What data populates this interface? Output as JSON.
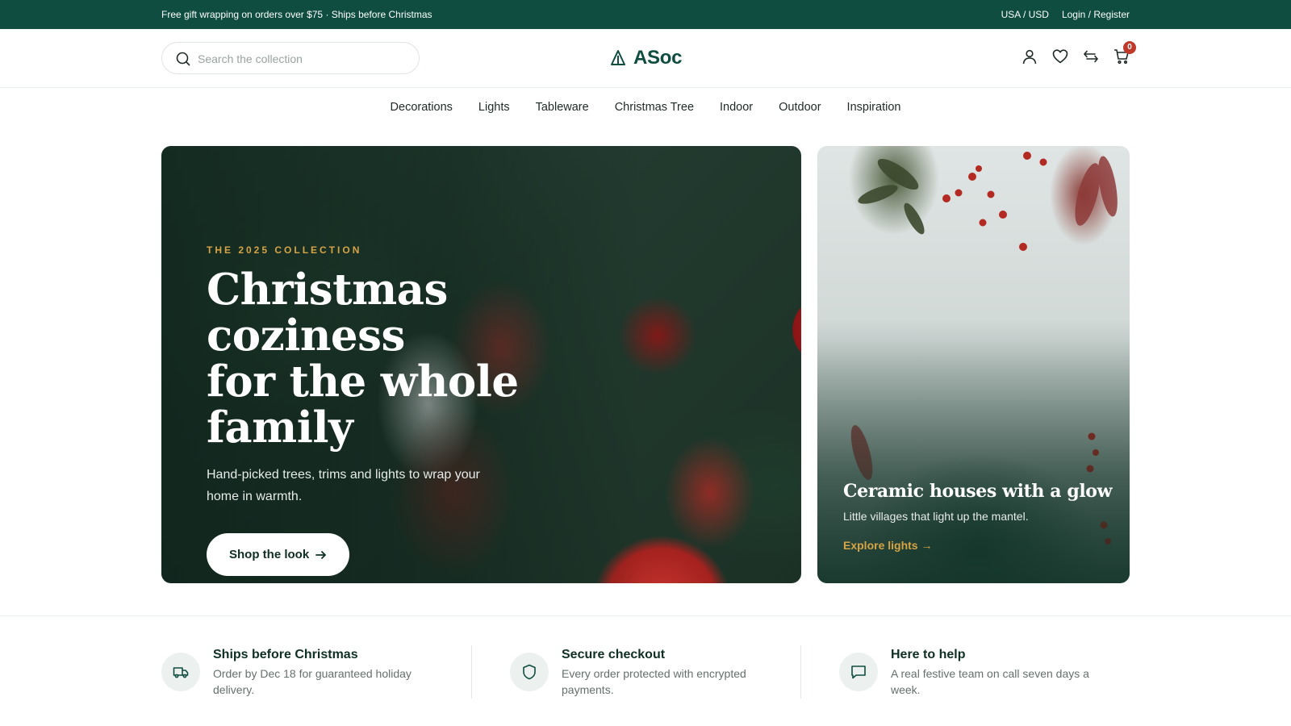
{
  "topbar": {
    "promo": "Free gift wrapping on orders over $75 · Ships before Christmas",
    "region": "USA / USD",
    "auth": "Login / Register"
  },
  "header": {
    "search_placeholder": "Search the collection",
    "logo": "ASoc",
    "cart_count": "0",
    "icons": [
      "user-icon",
      "heart-icon",
      "compare-icon",
      "cart-icon"
    ]
  },
  "nav": {
    "items": [
      "Decorations",
      "Lights",
      "Tableware",
      "Christmas Tree",
      "Indoor",
      "Outdoor",
      "Inspiration"
    ]
  },
  "hero": {
    "eyebrow": "THE 2025 COLLECTION",
    "title_line1": "Christmas coziness",
    "title_line2": "for the whole family",
    "subtitle": "Hand-picked trees, trims and lights to wrap your home in warmth.",
    "cta": "Shop the look"
  },
  "side_card": {
    "title": "Ceramic houses with a glow",
    "subtitle": "Little villages that light up the mantel.",
    "link": "Explore lights"
  },
  "features": [
    {
      "icon": "truck-icon",
      "title": "Ships before Christmas",
      "text": "Order by Dec 18 for guaranteed holiday delivery."
    },
    {
      "icon": "shield-icon",
      "title": "Secure checkout",
      "text": "Every order protected with encrypted payments."
    },
    {
      "icon": "chat-icon",
      "title": "Here to help",
      "text": "A real festive team on call seven days a week."
    }
  ],
  "colors": {
    "brand_green": "#0e4d3f",
    "accent_gold": "#d6a444",
    "badge_red": "#c0392b"
  }
}
